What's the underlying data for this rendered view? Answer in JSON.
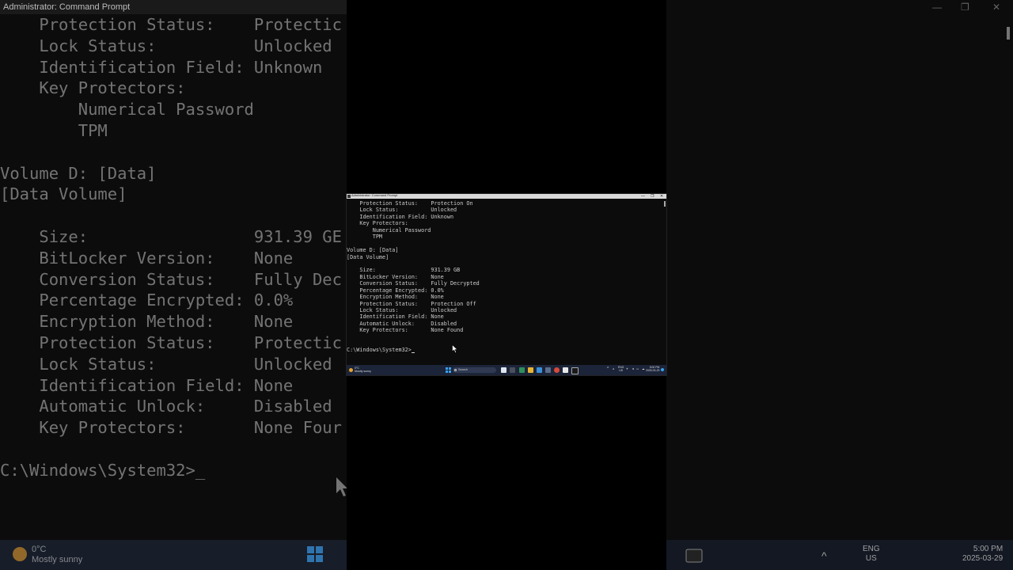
{
  "window": {
    "title": "Administrator: Command Prompt",
    "minimize": "—",
    "maximize": "❐",
    "close": "✕"
  },
  "terminal": {
    "lines": [
      "    Protection Status:    Protection On",
      "    Lock Status:          Unlocked",
      "    Identification Field: Unknown",
      "    Key Protectors:",
      "        Numerical Password",
      "        TPM",
      "",
      "Volume D: [Data]",
      "[Data Volume]",
      "",
      "    Size:                 931.39 GB",
      "    BitLocker Version:    None",
      "    Conversion Status:    Fully Decrypted",
      "    Percentage Encrypted: 0.0%",
      "    Encryption Method:    None",
      "    Protection Status:    Protection Off",
      "    Lock Status:          Unlocked",
      "    Identification Field: None",
      "    Automatic Unlock:     Disabled",
      "    Key Protectors:       None Found",
      ""
    ],
    "prompt": "C:\\Windows\\System32>"
  },
  "background_terminal": {
    "lines": [
      "    Protection Status:    Protectic",
      "    Lock Status:          Unlocked",
      "    Identification Field: Unknown",
      "    Key Protectors:",
      "        Numerical Password",
      "        TPM",
      "",
      "Volume D: [Data]",
      "[Data Volume]",
      "",
      "    Size:                 931.39 GE",
      "    BitLocker Version:    None",
      "    Conversion Status:    Fully Dec",
      "    Percentage Encrypted: 0.0%",
      "    Encryption Method:    None",
      "    Protection Status:    Protectic",
      "    Lock Status:          Unlocked",
      "    Identification Field: None",
      "    Automatic Unlock:     Disabled",
      "    Key Protectors:       None Four",
      "",
      "C:\\Windows\\System32>_"
    ]
  },
  "taskbar": {
    "weather_temp": "0°C",
    "weather_desc": "Mostly sunny",
    "search_placeholder": "Search",
    "lang_top": "ENG",
    "lang_bottom": "US",
    "time": "5:00 PM",
    "date": "2025-03-29"
  },
  "colors": {
    "terminal_bg": "#0c0c0c",
    "terminal_text": "#cccccc",
    "taskbar_bg": "#1b2438",
    "start_blue": "#3aa0f0"
  }
}
